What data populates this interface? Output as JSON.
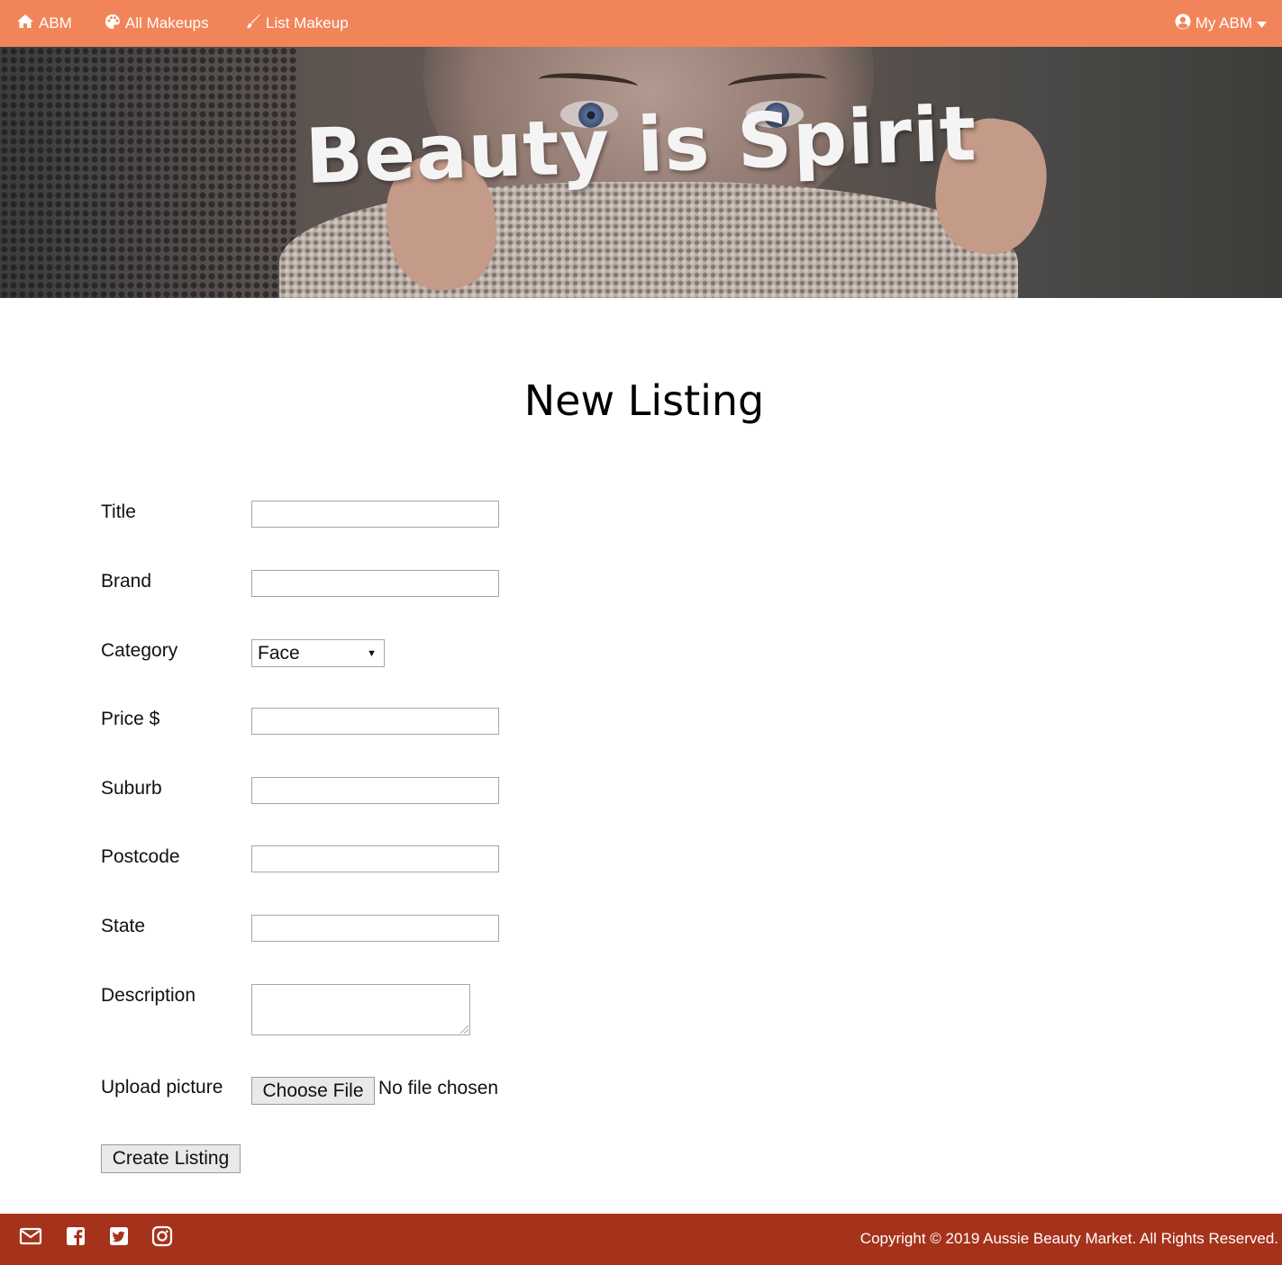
{
  "nav": {
    "home_label": "ABM",
    "all_makeups_label": "All Makeups",
    "list_makeup_label": "List Makeup",
    "account_label": "My ABM",
    "background_color": "#f2845a"
  },
  "hero": {
    "title": "Beauty is Spirit"
  },
  "page": {
    "title": "New Listing"
  },
  "form": {
    "fields": [
      {
        "label": "Title",
        "value": ""
      },
      {
        "label": "Brand",
        "value": ""
      },
      {
        "label": "Category",
        "selected": "Face"
      },
      {
        "label": "Price $",
        "value": ""
      },
      {
        "label": "Suburb",
        "value": ""
      },
      {
        "label": "Postcode",
        "value": ""
      },
      {
        "label": "State",
        "value": ""
      },
      {
        "label": "Description",
        "value": ""
      },
      {
        "label": "Upload picture",
        "button_label": "Choose File",
        "status": "No file chosen"
      }
    ],
    "submit_label": "Create Listing"
  },
  "footer": {
    "social_icons": [
      "mail-icon",
      "facebook-icon",
      "twitter-icon",
      "instagram-icon"
    ],
    "copyright": "Copyright © 2019 Aussie Beauty Market. All Rights Reserved.",
    "background_color": "#a5321b"
  }
}
